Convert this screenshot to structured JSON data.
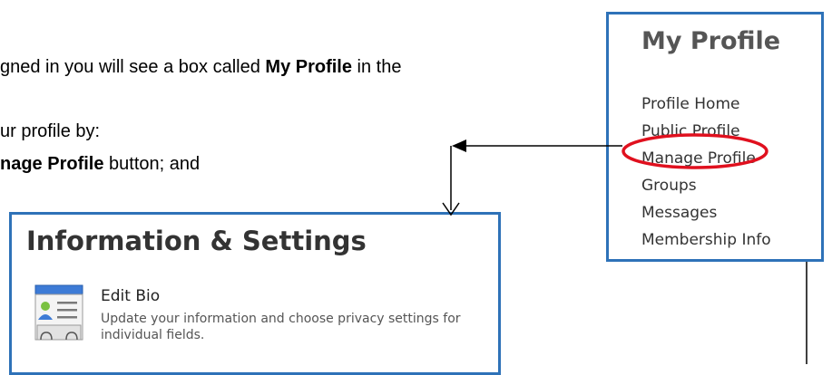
{
  "instructions": {
    "line1_prefix": "gned in you will see a box called ",
    "line1_bold": "My Profile",
    "line1_suffix": " in the",
    "line2": "ur profile by:",
    "line3_bold": "nage Profile",
    "line3_suffix": " button; and"
  },
  "my_profile": {
    "title": "My Profile",
    "links": [
      "Profile Home",
      "Public Profile",
      "Manage Profile",
      "Groups",
      "Messages",
      "Membership Info"
    ],
    "highlighted_link": "Manage Profile"
  },
  "information_settings": {
    "title": "Information & Settings",
    "edit_bio": {
      "label": "Edit Bio",
      "description": "Update your information and choose privacy settings for individual fields.",
      "icon": "profile-card-icon"
    }
  },
  "colors": {
    "panel_border": "#2e72b8",
    "highlight_ellipse": "#e0101e",
    "arrow": "#000000"
  }
}
